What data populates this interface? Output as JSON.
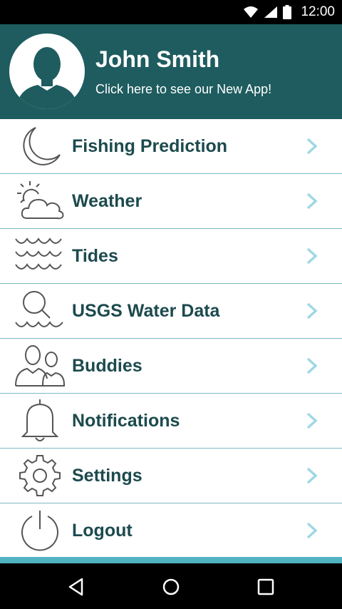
{
  "status_bar": {
    "time": "12:00",
    "icons": [
      "wifi-icon",
      "signal-icon",
      "battery-icon"
    ]
  },
  "header": {
    "user_name": "John Smith",
    "subtitle": "Click here to see our New App!",
    "background_color": "#1e5c5f",
    "avatar_icon": "person-silhouette-icon"
  },
  "menu": {
    "items": [
      {
        "label": "Fishing Prediction",
        "icon": "moon-icon"
      },
      {
        "label": "Weather",
        "icon": "sun-cloud-icon"
      },
      {
        "label": "Tides",
        "icon": "waves-icon"
      },
      {
        "label": "USGS Water Data",
        "icon": "magnifier-waves-icon"
      },
      {
        "label": "Buddies",
        "icon": "buddies-icon"
      },
      {
        "label": "Notifications",
        "icon": "bell-icon"
      },
      {
        "label": "Settings",
        "icon": "gear-icon"
      },
      {
        "label": "Logout",
        "icon": "power-icon"
      }
    ],
    "label_color": "#1c4a4e",
    "chevron_color": "#9fd8e3",
    "divider_color": "#7db8c4"
  },
  "accent_color": "#4fb3c1",
  "nav_bar": {
    "buttons": [
      "back-icon",
      "home-icon",
      "recents-icon"
    ]
  }
}
